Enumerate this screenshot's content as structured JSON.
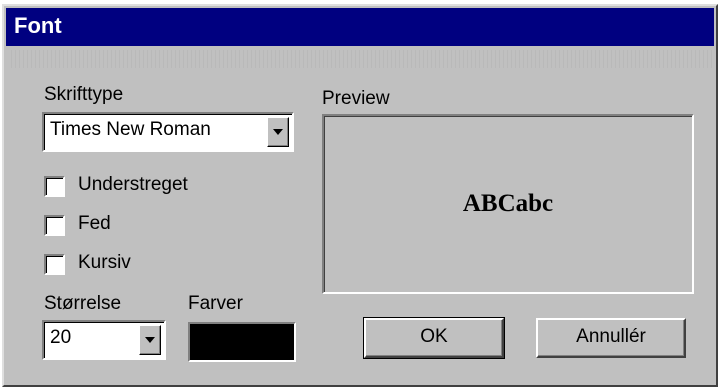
{
  "window": {
    "title": "Font"
  },
  "font_type": {
    "label": "Skrifttype",
    "value": "Times New Roman"
  },
  "options": [
    {
      "label": "Understreget",
      "checked": false
    },
    {
      "label": "Fed",
      "checked": false
    },
    {
      "label": "Kursiv",
      "checked": false
    }
  ],
  "size": {
    "label": "Størrelse",
    "value": "20"
  },
  "color": {
    "label": "Farver",
    "value": "#000000"
  },
  "preview": {
    "label": "Preview",
    "sample": "ABCabc"
  },
  "buttons": {
    "ok": "OK",
    "cancel": "Annullér"
  }
}
